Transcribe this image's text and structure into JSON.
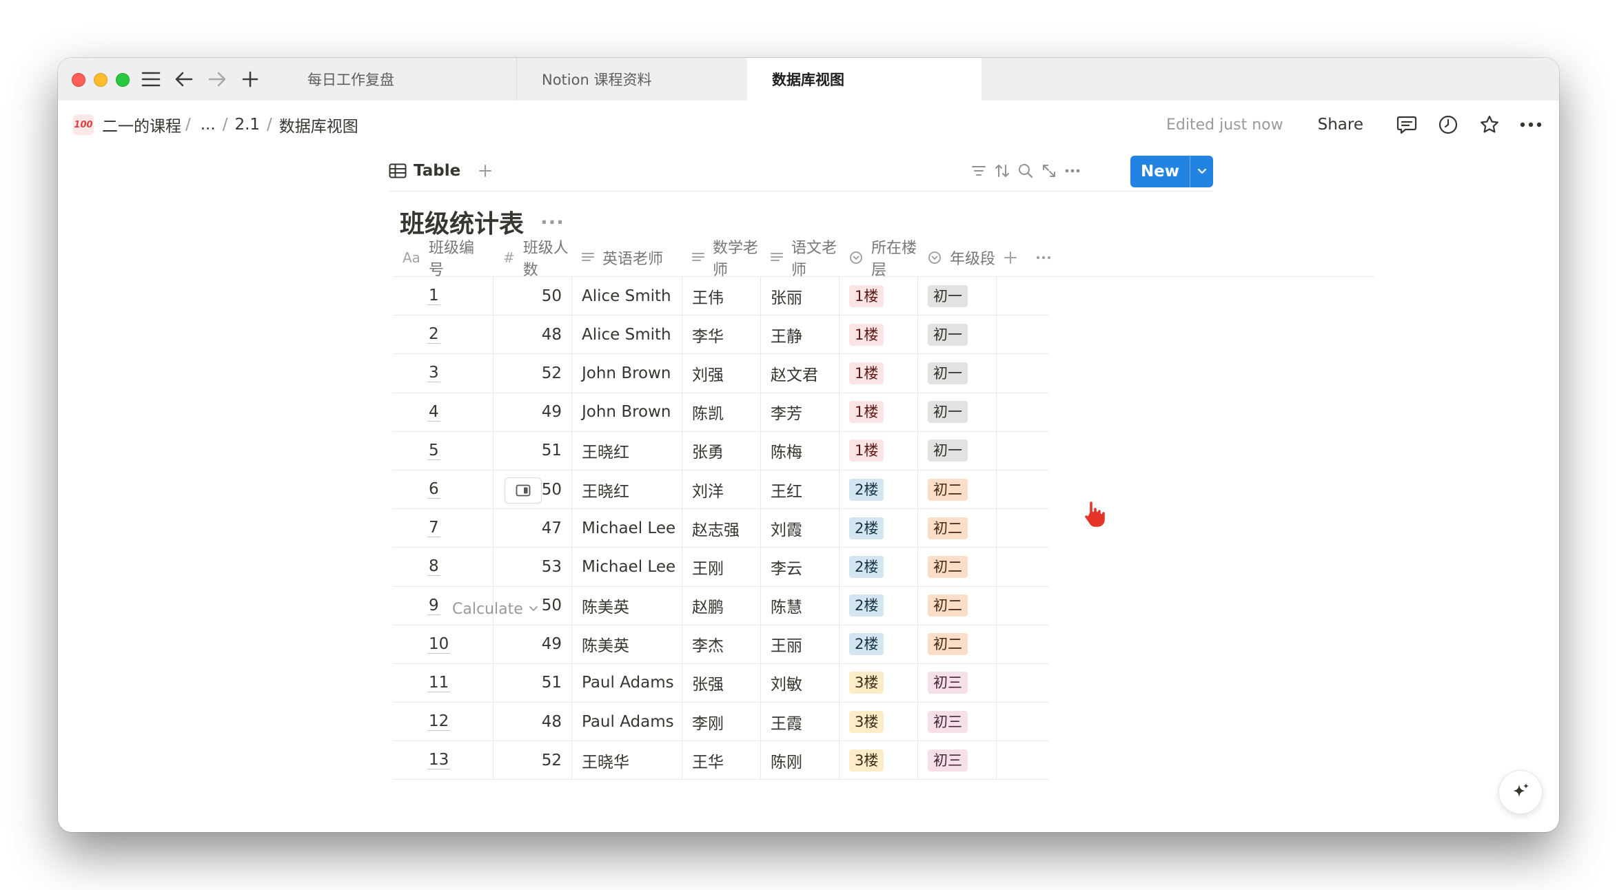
{
  "tabs": [
    {
      "label": "每日工作复盘"
    },
    {
      "label": "Notion 课程资料"
    },
    {
      "label": "数据库视图"
    }
  ],
  "breadcrumb": {
    "emoji": "100",
    "items": [
      "二一的课程",
      "...",
      "2.1",
      "数据库视图"
    ]
  },
  "topbar": {
    "edited": "Edited just now",
    "share": "Share"
  },
  "view": {
    "tab_label": "Table",
    "new_label": "New"
  },
  "database": {
    "title": "班级统计表",
    "more": "···"
  },
  "table": {
    "columns": [
      {
        "icon": "Aa",
        "label": "班级编号"
      },
      {
        "icon": "#",
        "label": "班级人数"
      },
      {
        "icon": "text-icon",
        "label": "英语老师"
      },
      {
        "icon": "text-icon",
        "label": "数学老师"
      },
      {
        "icon": "text-icon",
        "label": "语文老师"
      },
      {
        "icon": "select-icon",
        "label": "所在楼层"
      },
      {
        "icon": "select-icon",
        "label": "年级段"
      }
    ],
    "rows": [
      [
        "1",
        "50",
        "Alice Smith",
        "王伟",
        "张丽",
        "1楼",
        "初一"
      ],
      [
        "2",
        "48",
        "Alice Smith",
        "李华",
        "王静",
        "1楼",
        "初一"
      ],
      [
        "3",
        "52",
        "John Brown",
        "刘强",
        "赵文君",
        "1楼",
        "初一"
      ],
      [
        "4",
        "49",
        "John Brown",
        "陈凯",
        "李芳",
        "1楼",
        "初一"
      ],
      [
        "5",
        "51",
        "王晓红",
        "张勇",
        "陈梅",
        "1楼",
        "初一"
      ],
      [
        "6",
        "50",
        "王晓红",
        "刘洋",
        "王红",
        "2楼",
        "初二"
      ],
      [
        "7",
        "47",
        "Michael Lee",
        "赵志强",
        "刘霞",
        "2楼",
        "初二"
      ],
      [
        "8",
        "53",
        "Michael Lee",
        "王刚",
        "李云",
        "2楼",
        "初二"
      ],
      [
        "9",
        "50",
        "陈美英",
        "赵鹏",
        "陈慧",
        "2楼",
        "初二"
      ],
      [
        "10",
        "49",
        "陈美英",
        "李杰",
        "王丽",
        "2楼",
        "初二"
      ],
      [
        "11",
        "51",
        "Paul Adams",
        "张强",
        "刘敏",
        "3楼",
        "初三"
      ],
      [
        "12",
        "48",
        "Paul Adams",
        "李刚",
        "王霞",
        "3楼",
        "初三"
      ],
      [
        "13",
        "52",
        "王晓华",
        "王华",
        "陈刚",
        "3楼",
        "初三"
      ]
    ],
    "tag_colors": {
      "1楼": {
        "bg": "#fbe4e4",
        "fg": "#5d1715"
      },
      "2楼": {
        "bg": "#d3e5ef",
        "fg": "#183347"
      },
      "3楼": {
        "bg": "#fdecc8",
        "fg": "#402c1b"
      },
      "初一": {
        "bg": "#e3e2e0",
        "fg": "#32302c"
      },
      "初二": {
        "bg": "#fadec9",
        "fg": "#49290e"
      },
      "初三": {
        "bg": "#f5e0e9",
        "fg": "#4c2337"
      }
    },
    "calculate_label": "Calculate"
  },
  "colors": {
    "accent": "#2383e2",
    "text": "#37352f",
    "muted": "#9b9a97"
  }
}
